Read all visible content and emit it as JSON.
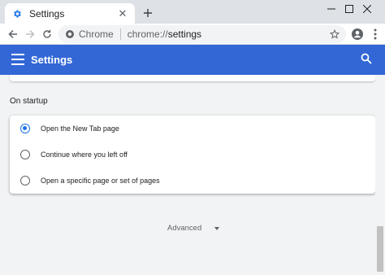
{
  "browser": {
    "tab": {
      "title": "Settings",
      "favicon": "gear-icon"
    },
    "toolbar": {
      "omnibox": {
        "chip": "Chrome",
        "url_scheme": "chrome://",
        "url_path": "settings"
      }
    }
  },
  "header": {
    "title": "Settings"
  },
  "startup": {
    "title": "On startup",
    "options": [
      {
        "label": "Open the New Tab page",
        "checked": true
      },
      {
        "label": "Continue where you left off",
        "checked": false
      },
      {
        "label": "Open a specific page or set of pages",
        "checked": false
      }
    ]
  },
  "advanced": {
    "label": "Advanced"
  },
  "colors": {
    "accent": "#3367d6",
    "radio_checked": "#1a73e8"
  }
}
